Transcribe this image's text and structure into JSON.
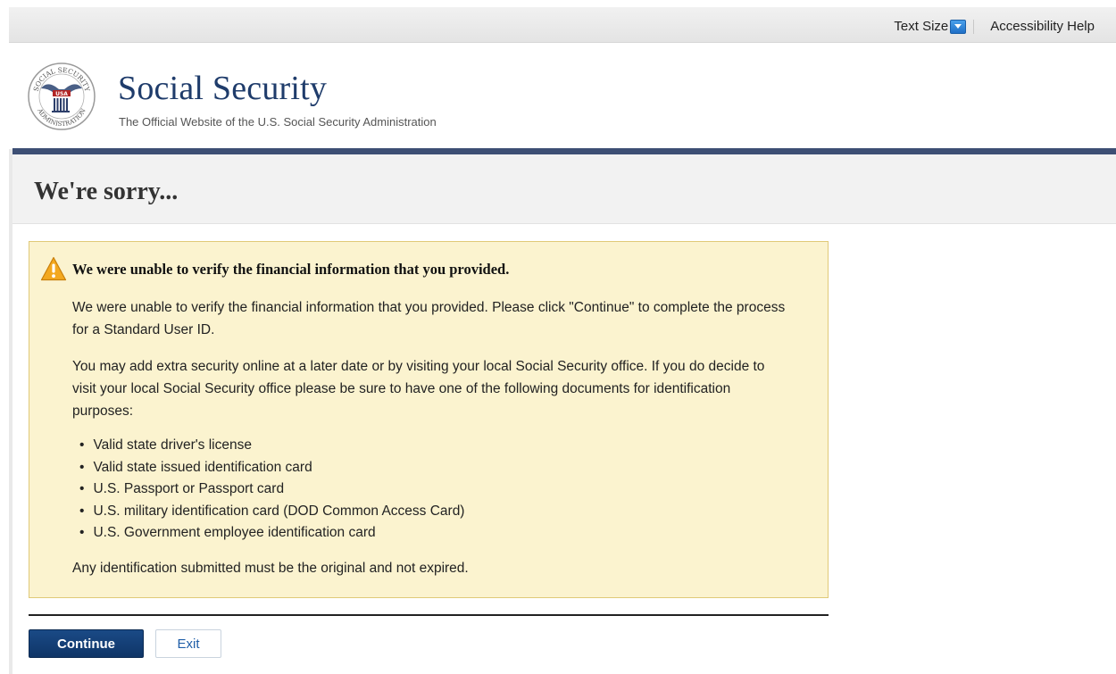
{
  "topbar": {
    "text_size_label": "Text Size",
    "accessibility_help_label": "Accessibility Help"
  },
  "header": {
    "seal_text_top": "SOCIAL SECURITY",
    "seal_text_bottom": "ADMINISTRATION",
    "seal_text_usa": "USA",
    "title": "Social Security",
    "tagline": "The Official Website of the U.S. Social Security Administration"
  },
  "page": {
    "title": "We're sorry..."
  },
  "alert": {
    "heading": "We were unable to verify the financial information that you provided.",
    "paragraph1": "We were unable to verify the financial information that you provided. Please click \"Continue\" to complete the process for a Standard User ID.",
    "paragraph2": "You may add extra security online at a later date or by visiting your local Social Security office. If you do decide to visit your local Social Security office please be sure to have one of the following documents for identification purposes:",
    "id_documents": [
      "Valid state driver's license",
      "Valid state issued identification card",
      "U.S. Passport or Passport card",
      "U.S. military identification card (DOD Common Access Card)",
      "U.S. Government employee identification card"
    ],
    "footer_note": "Any identification submitted must be the original and not expired."
  },
  "actions": {
    "continue_label": "Continue",
    "exit_label": "Exit"
  },
  "colors": {
    "brand_navy": "#1f3c6b",
    "navy_bar": "#3d4f74",
    "alert_background": "#fbf3cf",
    "alert_border": "#e0c978",
    "primary_button": "#1a4a86",
    "link_blue": "#1f5ea8"
  }
}
